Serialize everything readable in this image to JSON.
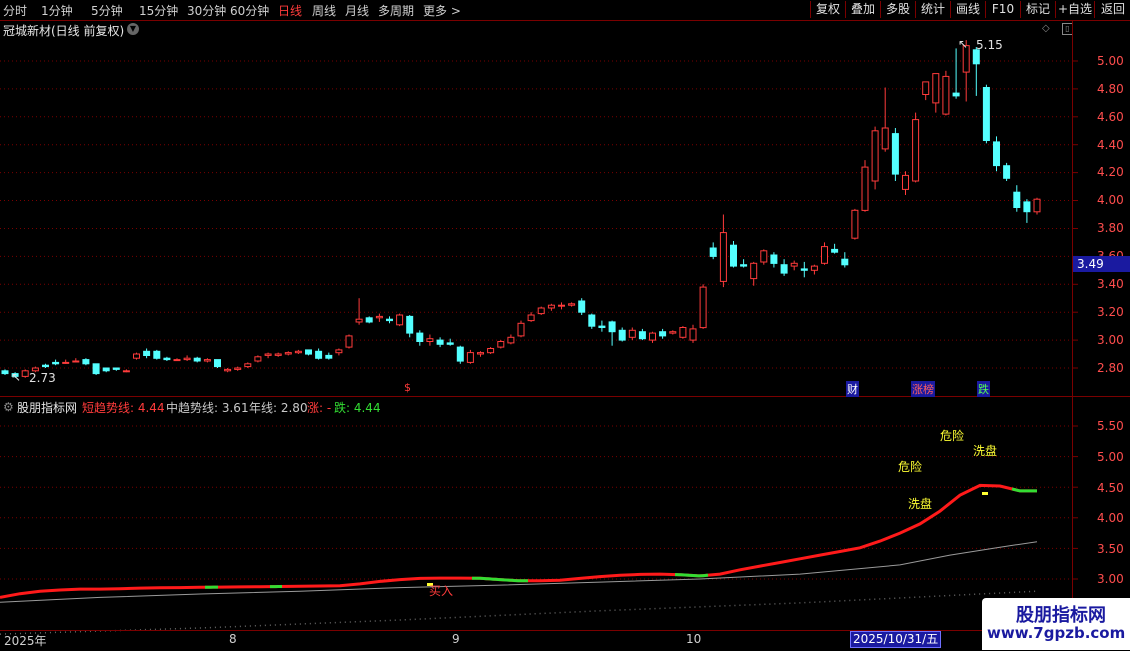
{
  "toolbar": {
    "periods": [
      "分时",
      "1分钟",
      "5分钟",
      "15分钟",
      "30分钟",
      "60分钟",
      "日线",
      "周线",
      "月线",
      "多周期",
      "更多 >"
    ],
    "active_period": "日线",
    "right_buttons": [
      "复权",
      "叠加",
      "多股",
      "统计",
      "画线",
      "F10",
      "标记",
      "+自选",
      "返回"
    ]
  },
  "main": {
    "title": "冠城新材(日线 前复权)",
    "high_label": "5.15",
    "low_label": "2.73",
    "current_price": "3.49",
    "y_ticks": [
      "5.00",
      "4.80",
      "4.60",
      "4.40",
      "4.20",
      "4.00",
      "3.80",
      "3.60",
      "3.40",
      "3.20",
      "3.00",
      "2.80"
    ],
    "markers": {
      "s": "$",
      "cai": "财",
      "zhangbang": "涨榜",
      "die": "跌"
    }
  },
  "indicator": {
    "name": "股朋指标网",
    "short_label": "短趋势线: 4.44",
    "mid_label": "中趋势线: 3.61",
    "year_label": "年线: 2.80",
    "zhang_label": "涨: -",
    "die_label": "跌: 4.44",
    "y_ticks": [
      "5.50",
      "5.00",
      "4.50",
      "4.00",
      "3.50",
      "3.00"
    ],
    "annotations": {
      "buy": "买入",
      "danger1": "危险",
      "danger2": "危险",
      "wash1": "洗盘",
      "wash2": "洗盘"
    }
  },
  "dates": {
    "year": "2025年",
    "m8": "8",
    "m9": "9",
    "m10": "10",
    "cursor": "2025/10/31/五"
  },
  "watermark": {
    "title": "股朋指标网",
    "url": "www.7gpzb.com"
  },
  "colors": {
    "up": "#ff3b3b",
    "down": "#54ffff",
    "trend_up": "#ff1a1a",
    "trend_down": "#33dd33",
    "year": "#9a9a9a",
    "grid": "#7a0000"
  },
  "chart_data": {
    "type": "candlestick",
    "ohlc": [
      [
        2.78,
        2.79,
        2.75,
        2.76
      ],
      [
        2.76,
        2.77,
        2.73,
        2.74
      ],
      [
        2.74,
        2.79,
        2.73,
        2.78
      ],
      [
        2.78,
        2.81,
        2.77,
        2.8
      ],
      [
        2.82,
        2.83,
        2.8,
        2.81
      ],
      [
        2.84,
        2.86,
        2.82,
        2.83
      ],
      [
        2.84,
        2.86,
        2.83,
        2.84
      ],
      [
        2.85,
        2.87,
        2.84,
        2.85
      ],
      [
        2.86,
        2.87,
        2.82,
        2.83
      ],
      [
        2.83,
        2.83,
        2.75,
        2.76
      ],
      [
        2.8,
        2.8,
        2.77,
        2.78
      ],
      [
        2.8,
        2.8,
        2.78,
        2.79
      ],
      [
        2.78,
        2.79,
        2.77,
        2.78
      ],
      [
        2.87,
        2.91,
        2.86,
        2.9
      ],
      [
        2.92,
        2.94,
        2.87,
        2.89
      ],
      [
        2.92,
        2.93,
        2.86,
        2.87
      ],
      [
        2.87,
        2.88,
        2.85,
        2.86
      ],
      [
        2.86,
        2.87,
        2.85,
        2.86
      ],
      [
        2.86,
        2.89,
        2.85,
        2.87
      ],
      [
        2.87,
        2.88,
        2.84,
        2.85
      ],
      [
        2.85,
        2.87,
        2.84,
        2.86
      ],
      [
        2.86,
        2.86,
        2.8,
        2.81
      ],
      [
        2.78,
        2.8,
        2.77,
        2.79
      ],
      [
        2.79,
        2.81,
        2.78,
        2.8
      ],
      [
        2.81,
        2.84,
        2.8,
        2.83
      ],
      [
        2.85,
        2.89,
        2.84,
        2.88
      ],
      [
        2.89,
        2.91,
        2.87,
        2.9
      ],
      [
        2.89,
        2.91,
        2.88,
        2.9
      ],
      [
        2.9,
        2.92,
        2.89,
        2.91
      ],
      [
        2.91,
        2.93,
        2.9,
        2.92
      ],
      [
        2.93,
        2.93,
        2.89,
        2.9
      ],
      [
        2.92,
        2.94,
        2.86,
        2.87
      ],
      [
        2.89,
        2.91,
        2.86,
        2.87
      ],
      [
        2.91,
        2.94,
        2.89,
        2.93
      ],
      [
        2.95,
        3.04,
        2.94,
        3.03
      ],
      [
        3.13,
        3.3,
        3.11,
        3.15
      ],
      [
        3.16,
        3.17,
        3.12,
        3.13
      ],
      [
        3.16,
        3.19,
        3.13,
        3.17
      ],
      [
        3.15,
        3.17,
        3.12,
        3.14
      ],
      [
        3.11,
        3.19,
        3.1,
        3.18
      ],
      [
        3.17,
        3.18,
        3.02,
        3.05
      ],
      [
        3.05,
        3.07,
        2.96,
        2.99
      ],
      [
        2.99,
        3.04,
        2.96,
        3.01
      ],
      [
        3.0,
        3.02,
        2.95,
        2.97
      ],
      [
        2.98,
        3.01,
        2.96,
        2.97
      ],
      [
        2.95,
        2.96,
        2.83,
        2.85
      ],
      [
        2.84,
        2.93,
        2.83,
        2.91
      ],
      [
        2.9,
        2.92,
        2.88,
        2.91
      ],
      [
        2.91,
        2.95,
        2.9,
        2.94
      ],
      [
        2.95,
        3.0,
        2.94,
        2.99
      ],
      [
        2.98,
        3.04,
        2.97,
        3.02
      ],
      [
        3.03,
        3.14,
        3.02,
        3.12
      ],
      [
        3.14,
        3.2,
        3.13,
        3.18
      ],
      [
        3.19,
        3.24,
        3.18,
        3.23
      ],
      [
        3.23,
        3.26,
        3.21,
        3.25
      ],
      [
        3.25,
        3.27,
        3.22,
        3.25
      ],
      [
        3.25,
        3.27,
        3.24,
        3.26
      ],
      [
        3.28,
        3.3,
        3.18,
        3.2
      ],
      [
        3.18,
        3.19,
        3.08,
        3.1
      ],
      [
        3.1,
        3.14,
        3.06,
        3.09
      ],
      [
        3.13,
        3.14,
        2.96,
        3.06
      ],
      [
        3.07,
        3.09,
        2.99,
        3.0
      ],
      [
        3.02,
        3.09,
        3.0,
        3.07
      ],
      [
        3.06,
        3.08,
        3.0,
        3.01
      ],
      [
        3.0,
        3.06,
        2.98,
        3.05
      ],
      [
        3.06,
        3.08,
        3.01,
        3.03
      ],
      [
        3.05,
        3.07,
        3.04,
        3.06
      ],
      [
        3.02,
        3.1,
        3.01,
        3.09
      ],
      [
        3.0,
        3.11,
        2.98,
        3.08
      ],
      [
        3.09,
        3.4,
        3.08,
        3.38
      ],
      [
        3.66,
        3.7,
        3.58,
        3.6
      ],
      [
        3.42,
        3.9,
        3.38,
        3.77
      ],
      [
        3.68,
        3.71,
        3.52,
        3.53
      ],
      [
        3.54,
        3.58,
        3.52,
        3.53
      ],
      [
        3.44,
        3.56,
        3.39,
        3.55
      ],
      [
        3.56,
        3.65,
        3.54,
        3.64
      ],
      [
        3.61,
        3.63,
        3.52,
        3.55
      ],
      [
        3.54,
        3.58,
        3.46,
        3.48
      ],
      [
        3.53,
        3.57,
        3.5,
        3.55
      ],
      [
        3.51,
        3.56,
        3.45,
        3.5
      ],
      [
        3.5,
        3.54,
        3.47,
        3.53
      ],
      [
        3.55,
        3.7,
        3.54,
        3.67
      ],
      [
        3.65,
        3.69,
        3.62,
        3.63
      ],
      [
        3.58,
        3.63,
        3.52,
        3.54
      ],
      [
        3.73,
        3.94,
        3.72,
        3.93
      ],
      [
        3.93,
        4.29,
        3.92,
        4.24
      ],
      [
        4.14,
        4.53,
        4.08,
        4.5
      ],
      [
        4.37,
        4.81,
        4.35,
        4.52
      ],
      [
        4.48,
        4.52,
        4.14,
        4.19
      ],
      [
        4.08,
        4.21,
        4.04,
        4.18
      ],
      [
        4.14,
        4.63,
        4.13,
        4.58
      ],
      [
        4.76,
        4.83,
        4.72,
        4.85
      ],
      [
        4.7,
        4.83,
        4.63,
        4.91
      ],
      [
        4.62,
        4.93,
        4.61,
        4.89
      ],
      [
        4.77,
        5.09,
        4.73,
        4.75
      ],
      [
        4.92,
        5.15,
        4.71,
        5.11
      ],
      [
        5.08,
        5.1,
        4.75,
        4.98
      ],
      [
        4.81,
        4.83,
        4.41,
        4.43
      ],
      [
        4.42,
        4.46,
        4.21,
        4.25
      ],
      [
        4.25,
        4.27,
        4.14,
        4.16
      ],
      [
        4.06,
        4.11,
        3.92,
        3.95
      ],
      [
        3.99,
        4.01,
        3.84,
        3.92
      ],
      [
        3.92,
        4.02,
        3.9,
        4.01
      ]
    ],
    "short_trend": [
      [
        0,
        2.7
      ],
      [
        20,
        2.76
      ],
      [
        40,
        2.8
      ],
      [
        60,
        2.82
      ],
      [
        80,
        2.835
      ],
      [
        100,
        2.835
      ],
      [
        120,
        2.84
      ],
      [
        140,
        2.852
      ],
      [
        160,
        2.856
      ],
      [
        180,
        2.86
      ],
      [
        200,
        2.865
      ],
      [
        220,
        2.868
      ],
      [
        240,
        2.871
      ],
      [
        260,
        2.874
      ],
      [
        280,
        2.877
      ],
      [
        300,
        2.88
      ],
      [
        320,
        2.885
      ],
      [
        340,
        2.89
      ],
      [
        360,
        2.92
      ],
      [
        380,
        2.96
      ],
      [
        400,
        2.99
      ],
      [
        420,
        3.01
      ],
      [
        440,
        3.015
      ],
      [
        460,
        3.015
      ],
      [
        480,
        3.012
      ],
      [
        500,
        2.99
      ],
      [
        520,
        2.97
      ],
      [
        540,
        2.97
      ],
      [
        560,
        2.98
      ],
      [
        580,
        3.01
      ],
      [
        600,
        3.04
      ],
      [
        620,
        3.06
      ],
      [
        640,
        3.075
      ],
      [
        660,
        3.08
      ],
      [
        680,
        3.07
      ],
      [
        700,
        3.05
      ],
      [
        720,
        3.08
      ],
      [
        740,
        3.15
      ],
      [
        760,
        3.21
      ],
      [
        780,
        3.27
      ],
      [
        800,
        3.33
      ],
      [
        820,
        3.39
      ],
      [
        840,
        3.45
      ],
      [
        860,
        3.51
      ],
      [
        880,
        3.62
      ],
      [
        900,
        3.75
      ],
      [
        920,
        3.9
      ],
      [
        940,
        4.11
      ],
      [
        960,
        4.37
      ],
      [
        980,
        4.53
      ],
      [
        1000,
        4.52
      ],
      [
        1020,
        4.44
      ],
      [
        1037,
        4.44
      ]
    ],
    "short_trend_down_ranges": [
      [
        205,
        218
      ],
      [
        270,
        282
      ],
      [
        472,
        528
      ],
      [
        675,
        708
      ],
      [
        1012,
        1037
      ]
    ],
    "mid_trend": [
      [
        0,
        2.62
      ],
      [
        100,
        2.7
      ],
      [
        200,
        2.755
      ],
      [
        300,
        2.8
      ],
      [
        400,
        2.86
      ],
      [
        500,
        2.9
      ],
      [
        600,
        2.95
      ],
      [
        700,
        3.0
      ],
      [
        800,
        3.08
      ],
      [
        900,
        3.23
      ],
      [
        950,
        3.39
      ],
      [
        1000,
        3.52
      ],
      [
        1037,
        3.61
      ]
    ],
    "year_line": [
      [
        0,
        2.1
      ],
      [
        200,
        2.2
      ],
      [
        400,
        2.33
      ],
      [
        600,
        2.48
      ],
      [
        800,
        2.61
      ],
      [
        1037,
        2.8
      ]
    ]
  }
}
